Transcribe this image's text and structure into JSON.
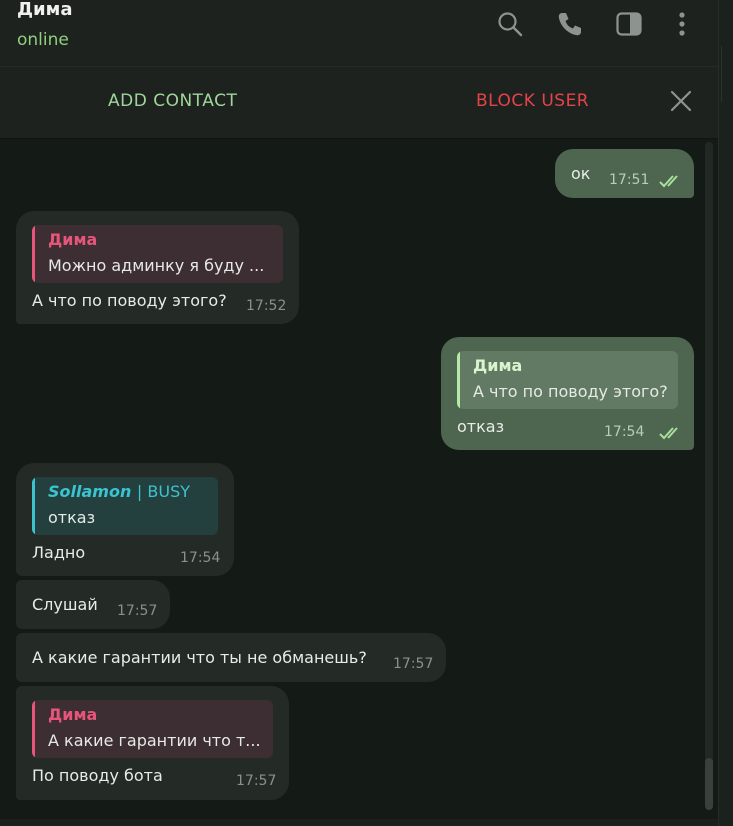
{
  "header": {
    "title": "Дима",
    "status": "online",
    "icons": [
      "search-icon",
      "phone-icon",
      "sidebar-panel-icon",
      "more-vertical-icon"
    ]
  },
  "actions": {
    "add_contact": "ADD CONTACT",
    "block_user": "BLOCK USER",
    "close_icon": "close-icon"
  },
  "messages": [
    {
      "direction": "out",
      "text": "ок",
      "time": "17:51",
      "read": true
    },
    {
      "direction": "in",
      "reply": {
        "name": "Дима",
        "text": "Можно админку я буду ..."
      },
      "text": "А что по поводу этого?",
      "time": "17:52"
    },
    {
      "direction": "out",
      "reply": {
        "name": "Дима",
        "text": "А что по поводу этого?"
      },
      "text": "отказ",
      "time": "17:54",
      "read": true
    },
    {
      "direction": "in",
      "reply": {
        "name": "Sollamon",
        "name_suffix": "| BUSY",
        "text": "отказ"
      },
      "text": "Ладно",
      "time": "17:54"
    },
    {
      "direction": "in",
      "text": "Слушай",
      "time": "17:57"
    },
    {
      "direction": "in",
      "text": "А какие гарантии что ты не обманешь?",
      "time": "17:57"
    },
    {
      "direction": "in",
      "reply": {
        "name": "Дима",
        "text": "А какие гарантии что т..."
      },
      "text": "По поводу бота",
      "time": "17:57"
    }
  ],
  "colors": {
    "accent_green": "#9fd69a",
    "danger_red": "#e5434a",
    "reply_pink": "#e8557a",
    "reply_teal": "#3bc3cf",
    "out_bubble": "#4e6650",
    "in_bubble": "#242a26"
  }
}
